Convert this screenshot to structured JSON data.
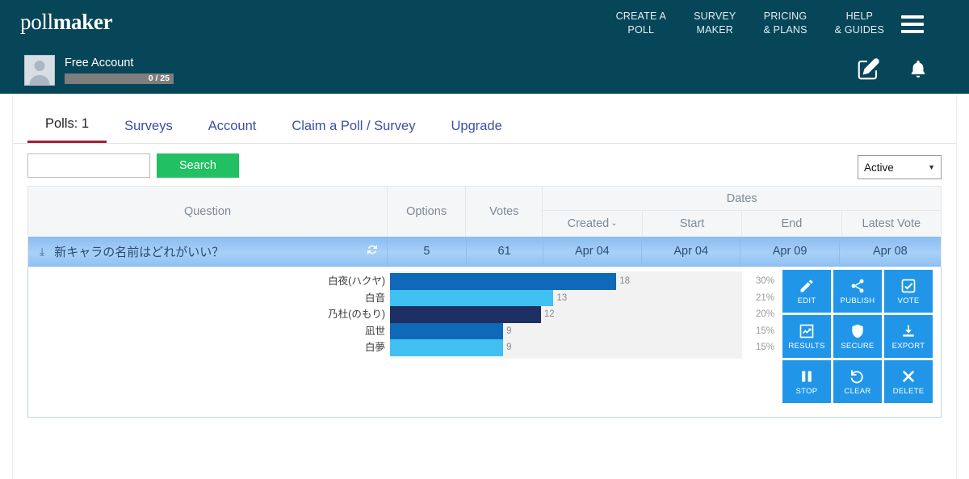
{
  "brand": {
    "light": "poll",
    "bold": "maker"
  },
  "header": {
    "nav": [
      {
        "line1": "CREATE A",
        "line2": "POLL"
      },
      {
        "line1": "SURVEY",
        "line2": "MAKER"
      },
      {
        "line1": "PRICING",
        "line2": "& PLANS"
      },
      {
        "line1": "HELP",
        "line2": "& GUIDES"
      }
    ],
    "menu_icon": "hamburger-menu-icon",
    "account": {
      "name": "Free Account",
      "quota": "0 / 25",
      "avatar_icon": "user-avatar-icon"
    },
    "icons": [
      {
        "name": "compose-icon"
      },
      {
        "name": "notifications-bell-icon"
      }
    ]
  },
  "tabs": [
    {
      "label": "Polls: 1",
      "active": true
    },
    {
      "label": "Surveys",
      "active": false
    },
    {
      "label": "Account",
      "active": false
    },
    {
      "label": "Claim a Poll / Survey",
      "active": false
    },
    {
      "label": "Upgrade",
      "active": false
    }
  ],
  "toolbar": {
    "search_value": "",
    "search_placeholder": "",
    "search_label": "Search",
    "status_value": "Active"
  },
  "table": {
    "headers": {
      "question": "Question",
      "options": "Options",
      "votes": "Votes",
      "dates": "Dates",
      "created": "Created",
      "created_sort": "⌄",
      "start": "Start",
      "end": "End",
      "latest_vote": "Latest Vote"
    },
    "row": {
      "question": "新キャラの名前はどれがいい？",
      "options": "5",
      "votes": "61",
      "created": "Apr 04",
      "start": "Apr 04",
      "end": "Apr 09",
      "latest_vote": "Apr 08",
      "expand_icon": "chevron-double-down-icon",
      "refresh_icon": "refresh-icon"
    }
  },
  "chart_data": {
    "type": "bar",
    "orientation": "horizontal",
    "title": "",
    "xlabel": "",
    "ylabel": "",
    "categories": [
      "白夜(ハクヤ)",
      "白音",
      "乃杜(のもり)",
      "凪世",
      "白夢"
    ],
    "values": [
      18,
      13,
      12,
      9,
      9
    ],
    "percents": [
      "30%",
      "21%",
      "20%",
      "15%",
      "15%"
    ],
    "colors": [
      "#1068b8",
      "#3fc0f0",
      "#1e2f63",
      "#1068b8",
      "#3fc0f0"
    ],
    "total_votes": 61,
    "xlim": [
      0,
      28
    ],
    "grid": false,
    "legend": "none"
  },
  "actions": [
    {
      "label": "EDIT",
      "icon": "pencil-icon"
    },
    {
      "label": "PUBLISH",
      "icon": "share-icon"
    },
    {
      "label": "VOTE",
      "icon": "checkbox-checked-icon"
    },
    {
      "label": "RESULTS",
      "icon": "chart-line-icon"
    },
    {
      "label": "SECURE",
      "icon": "shield-icon"
    },
    {
      "label": "EXPORT",
      "icon": "download-icon"
    },
    {
      "label": "STOP",
      "icon": "pause-icon"
    },
    {
      "label": "CLEAR",
      "icon": "history-undo-icon"
    },
    {
      "label": "DELETE",
      "icon": "close-x-icon"
    }
  ],
  "colors": {
    "header_bg": "#074558",
    "accent_green": "#20c063",
    "accent_blue": "#2196e8",
    "tab_active_underline": "#a11f3c",
    "row_highlight": "#a8d0f7"
  }
}
